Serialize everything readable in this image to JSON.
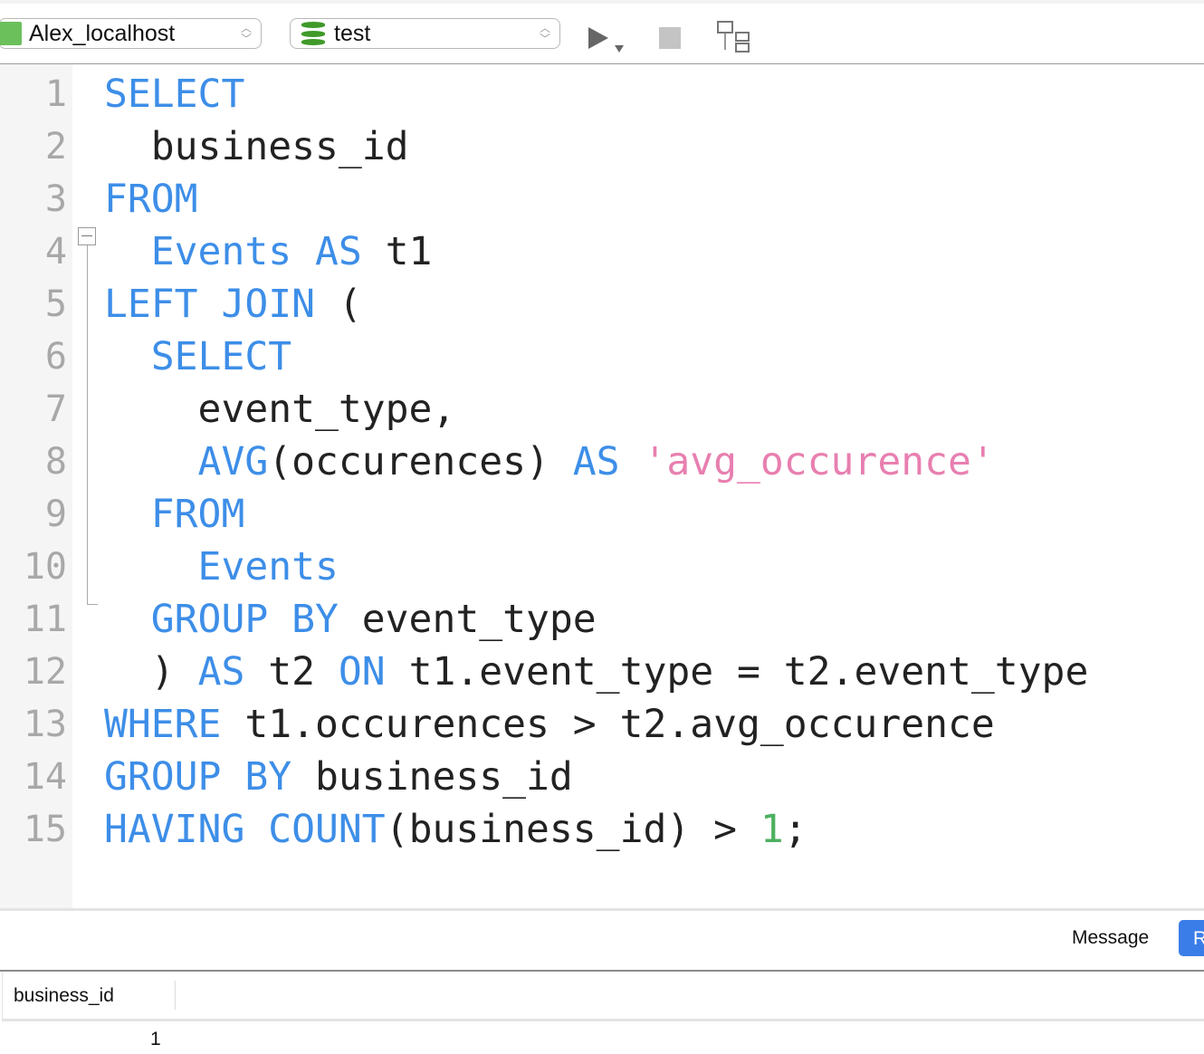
{
  "toolbar": {
    "connection": "Alex_localhost",
    "database": "test",
    "icons": [
      "mysql-dolphin-icon",
      "database-icon",
      "run-icon",
      "stop-icon",
      "explain-icon"
    ]
  },
  "editor": {
    "lines": [
      [
        [
          "kw",
          "SELECT"
        ]
      ],
      [
        [
          "t",
          "  business_id"
        ]
      ],
      [
        [
          "kw",
          "FROM"
        ]
      ],
      [
        [
          "kw",
          "  Events"
        ],
        [
          "t",
          " "
        ],
        [
          "kw",
          "AS"
        ],
        [
          "t",
          " t1"
        ]
      ],
      [
        [
          "kw",
          "LEFT JOIN"
        ],
        [
          "t",
          " ("
        ]
      ],
      [
        [
          "kw",
          "  SELECT"
        ]
      ],
      [
        [
          "t",
          "    event_type,"
        ]
      ],
      [
        [
          "kw",
          "    AVG"
        ],
        [
          "t",
          "(occurences) "
        ],
        [
          "kw",
          "AS"
        ],
        [
          "t",
          " "
        ],
        [
          "str",
          "'avg_occurence'"
        ]
      ],
      [
        [
          "kw",
          "  FROM"
        ]
      ],
      [
        [
          "kw",
          "    Events"
        ]
      ],
      [
        [
          "kw",
          "  GROUP BY"
        ],
        [
          "t",
          " event_type"
        ]
      ],
      [
        [
          "t",
          "  ) "
        ],
        [
          "kw",
          "AS"
        ],
        [
          "t",
          " t2 "
        ],
        [
          "kw",
          "ON"
        ],
        [
          "t",
          " t1.event_type = t2.event_type"
        ]
      ],
      [
        [
          "kw",
          "WHERE"
        ],
        [
          "t",
          " t1.occurences > t2.avg_occurence"
        ]
      ],
      [
        [
          "kw",
          "GROUP BY"
        ],
        [
          "t",
          " business_id"
        ]
      ],
      [
        [
          "kw",
          "HAVING"
        ],
        [
          "t",
          " "
        ],
        [
          "kw",
          "COUNT"
        ],
        [
          "t",
          "(business_id) > "
        ],
        [
          "num",
          "1"
        ],
        [
          "t",
          ";"
        ]
      ]
    ]
  },
  "results": {
    "tabs": {
      "message": "Message",
      "result": "R"
    },
    "columns": [
      "business_id"
    ],
    "rows": [
      [
        "1"
      ]
    ]
  }
}
